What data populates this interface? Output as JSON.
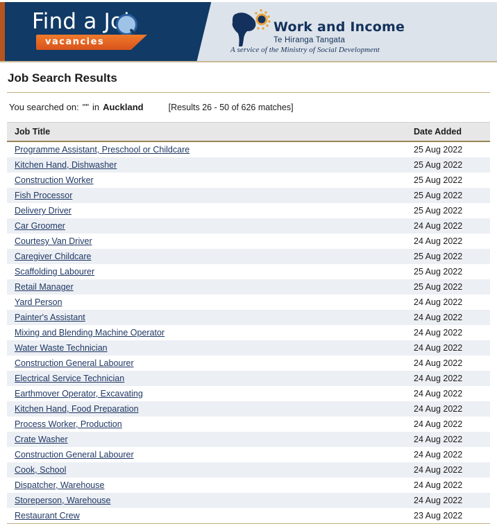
{
  "header": {
    "find_a_job_title": "Find a Job",
    "vacancies_badge": "vacancies",
    "work_and_income_name": "Work and Income",
    "work_and_income_maori": "Te Hiranga Tangata",
    "tagline": "A service of the Ministry of Social Development",
    "colors": {
      "navy": "#113a66",
      "panel": "#dde3ea",
      "orange": "#d9531c",
      "tan_border": "#c9b896"
    }
  },
  "page": {
    "title": "Job Search Results"
  },
  "search": {
    "prefix": "You searched on:",
    "query": "\"\"",
    "in_word": "in",
    "region": "Auckland",
    "results_summary": "[Results 26 - 50 of 626 matches]"
  },
  "table": {
    "columns": {
      "job_title": "Job Title",
      "date_added": "Date Added"
    },
    "rows": [
      {
        "title": "Programme Assistant, Preschool or Childcare",
        "date": "25 Aug 2022"
      },
      {
        "title": "Kitchen Hand, Dishwasher",
        "date": "25 Aug 2022"
      },
      {
        "title": "Construction Worker",
        "date": "25 Aug 2022"
      },
      {
        "title": "Fish Processor",
        "date": "25 Aug 2022"
      },
      {
        "title": "Delivery Driver",
        "date": "25 Aug 2022"
      },
      {
        "title": "Car Groomer",
        "date": "24 Aug 2022"
      },
      {
        "title": "Courtesy Van Driver",
        "date": "24 Aug 2022"
      },
      {
        "title": "Caregiver Childcare",
        "date": "25 Aug 2022"
      },
      {
        "title": "Scaffolding Labourer",
        "date": "25 Aug 2022"
      },
      {
        "title": "Retail Manager",
        "date": "25 Aug 2022"
      },
      {
        "title": "Yard Person",
        "date": "24 Aug 2022"
      },
      {
        "title": "Painter's Assistant",
        "date": "24 Aug 2022"
      },
      {
        "title": "Mixing and Blending Machine Operator",
        "date": "24 Aug 2022"
      },
      {
        "title": "Water Waste Technician",
        "date": "24 Aug 2022"
      },
      {
        "title": "Construction General Labourer",
        "date": "24 Aug 2022"
      },
      {
        "title": "Electrical Service Technician",
        "date": "24 Aug 2022"
      },
      {
        "title": "Earthmover Operator, Excavating",
        "date": "24 Aug 2022"
      },
      {
        "title": "Kitchen Hand, Food Preparation",
        "date": "24 Aug 2022"
      },
      {
        "title": "Process Worker, Production",
        "date": "24 Aug 2022"
      },
      {
        "title": "Crate Washer",
        "date": "24 Aug 2022"
      },
      {
        "title": "Construction General Labourer",
        "date": "24 Aug 2022"
      },
      {
        "title": "Cook, School",
        "date": "24 Aug 2022"
      },
      {
        "title": "Dispatcher, Warehouse",
        "date": "24 Aug 2022"
      },
      {
        "title": "Storeperson, Warehouse",
        "date": "24 Aug 2022"
      },
      {
        "title": "Restaurant Crew",
        "date": "23 Aug 2022"
      }
    ]
  }
}
